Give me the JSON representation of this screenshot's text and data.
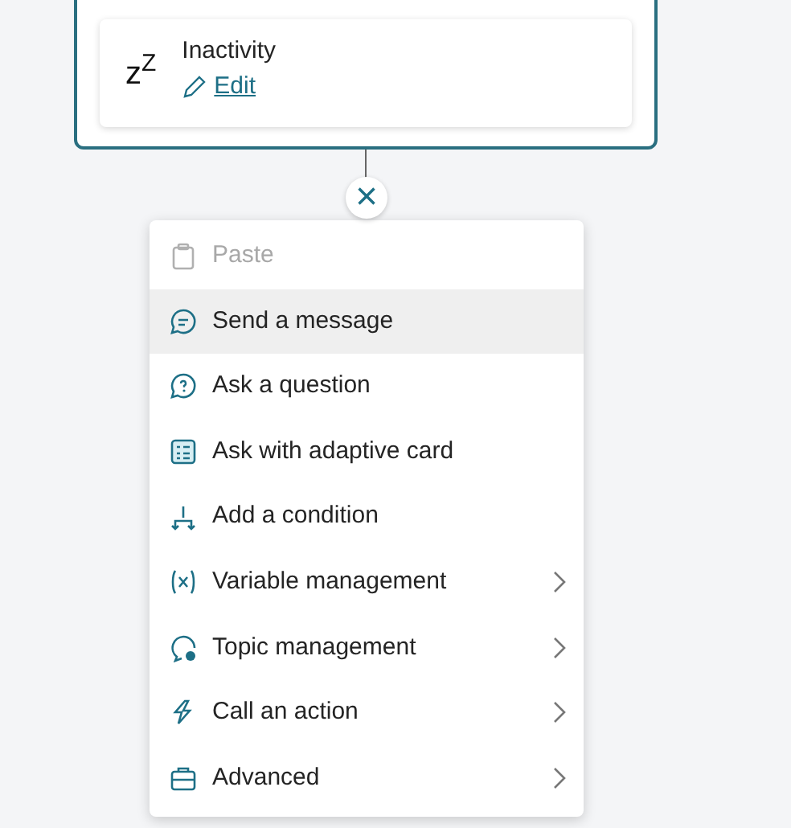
{
  "node": {
    "card": {
      "icon_text": "z$^{Z}$",
      "title": "Inactivity",
      "edit_link": "Edit"
    }
  },
  "close_button": {
    "label": "×"
  },
  "menu": {
    "items": [
      {
        "label": "Paste",
        "disabled": true,
        "highlighted": false,
        "submenu": false
      },
      {
        "label": "Send a message",
        "disabled": false,
        "highlighted": true,
        "submenu": false
      },
      {
        "label": "Ask a question",
        "disabled": false,
        "highlighted": false,
        "submenu": false
      },
      {
        "label": "Ask with adaptive card",
        "disabled": false,
        "highlighted": false,
        "submenu": false
      },
      {
        "label": "Add a condition",
        "disabled": false,
        "highlighted": false,
        "submenu": false
      },
      {
        "label": "Variable management",
        "disabled": false,
        "highlighted": false,
        "submenu": true
      },
      {
        "label": "Topic management",
        "disabled": false,
        "highlighted": false,
        "submenu": true
      },
      {
        "label": "Call an action",
        "disabled": false,
        "highlighted": false,
        "submenu": true
      },
      {
        "label": "Advanced",
        "disabled": false,
        "highlighted": false,
        "submenu": true
      }
    ]
  }
}
